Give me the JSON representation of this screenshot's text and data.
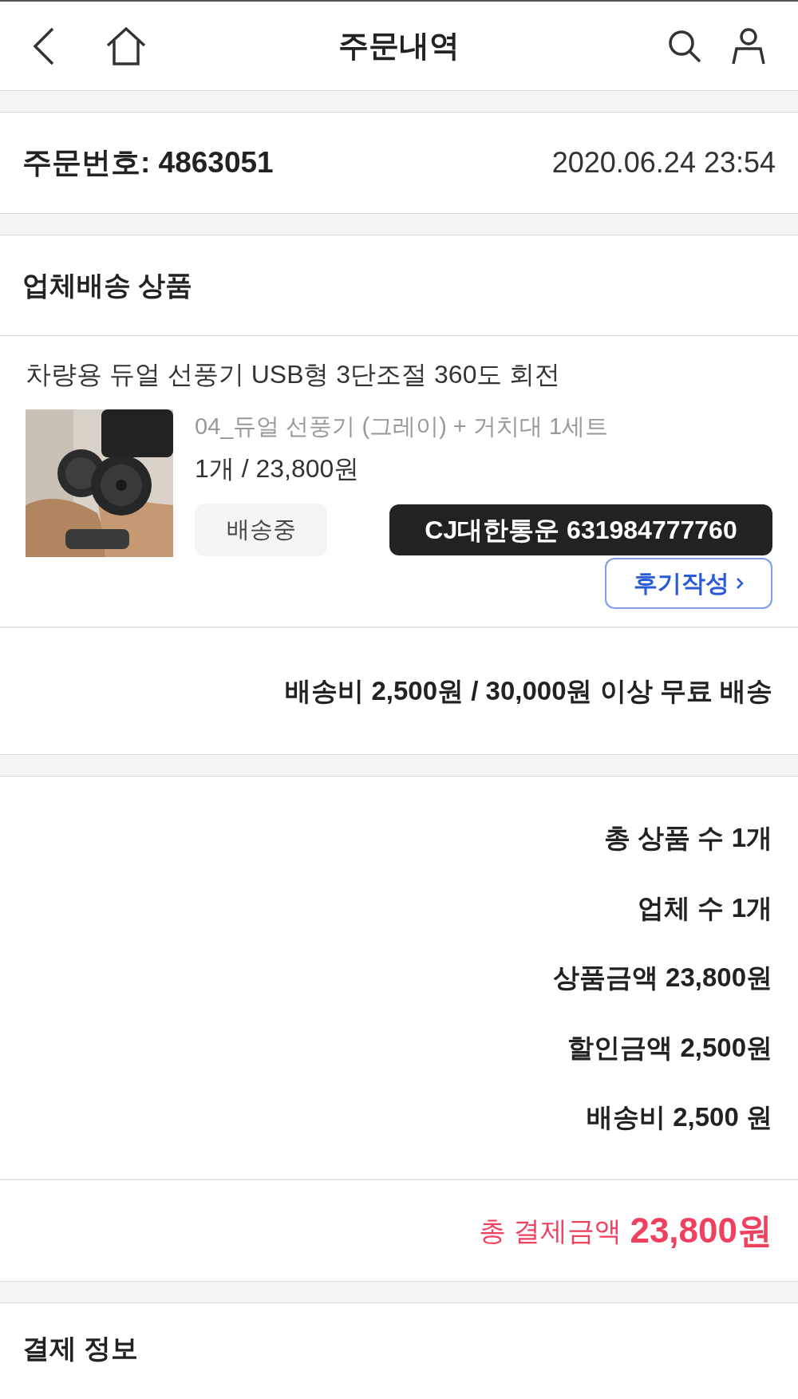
{
  "header": {
    "title": "주문내역"
  },
  "order": {
    "number": "주문번호: 4863051",
    "date": "2020.06.24 23:54"
  },
  "section_title": "업체배송 상품",
  "product": {
    "name": "차량용 듀얼 선풍기 USB형 3단조절 360도 회전",
    "option": "04_듀얼 선풍기 (그레이) + 거치대 1세트",
    "quantity_price": "1개 / 23,800원",
    "status": "배송중",
    "tracking": "CJ대한통운 631984777760",
    "review_button": "후기작성"
  },
  "shipping_note": "배송비 2,500원 / 30,000원 이상 무료 배송",
  "summary": [
    "총 상품 수 1개",
    "업체 수 1개",
    "상품금액 23,800원",
    "할인금액 2,500원",
    "배송비 2,500 원"
  ],
  "total": {
    "label": "총 결제금액",
    "amount": "23,800원"
  },
  "payment_title": "결제 정보"
}
